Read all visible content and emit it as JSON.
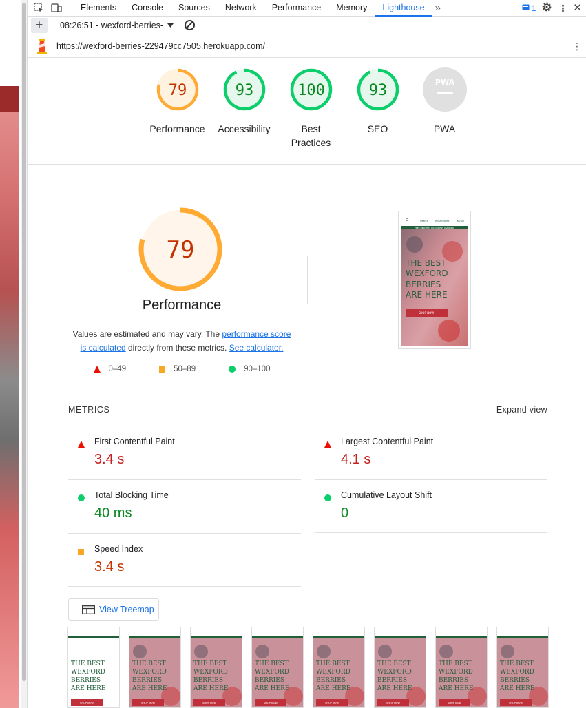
{
  "tabs": [
    "Elements",
    "Console",
    "Sources",
    "Network",
    "Performance",
    "Memory",
    "Lighthouse"
  ],
  "active_tab": "Lighthouse",
  "more_tabs_glyph": "»",
  "issues_count": "1",
  "toolbar": {
    "report_label": "08:26:51 - wexford-berries-",
    "add_glyph": "+"
  },
  "url": "https://wexford-berries-229479cc7505.herokuapp.com/",
  "gauges": [
    {
      "score": "79",
      "label": "Performance",
      "color": "#fa3",
      "text_color": "#c33300",
      "value": 79
    },
    {
      "score": "93",
      "label": "Accessibility",
      "color": "#0cce6b",
      "text_color": "#0a8a20",
      "value": 93
    },
    {
      "score": "100",
      "label": "Best Practices",
      "color": "#0cce6b",
      "text_color": "#0a8a20",
      "value": 100
    },
    {
      "score": "93",
      "label": "SEO",
      "color": "#0cce6b",
      "text_color": "#0a8a20",
      "value": 93
    },
    {
      "score": "PWA",
      "label": "PWA",
      "color": "#9e9e9e",
      "text_color": "#fff",
      "value": 0
    }
  ],
  "main": {
    "score": "79",
    "title": "Performance",
    "desc_1": "Values are estimated and may vary. The ",
    "link_1": "performance score",
    "link_1b": "is calculated",
    "desc_2": " directly from these metrics. ",
    "link_2": "See calculator.",
    "legend": [
      "0–49",
      "50–89",
      "90–100"
    ]
  },
  "preview": {
    "banner": "FREE DELIVERY ON ORDERS OVER €50",
    "headline": [
      "THE BEST",
      "WEXFORD",
      "BERRIES",
      "ARE HERE"
    ],
    "cta": "SHOP NOW",
    "nav": [
      "Search",
      "My Account",
      "€0.00"
    ]
  },
  "metrics": {
    "heading": "METRICS",
    "expand": "Expand view",
    "items": [
      {
        "name": "First Contentful Paint",
        "value": "3.4 s",
        "status": "fail"
      },
      {
        "name": "Largest Contentful Paint",
        "value": "4.1 s",
        "status": "fail"
      },
      {
        "name": "Total Blocking Time",
        "value": "40 ms",
        "status": "pass"
      },
      {
        "name": "Cumulative Layout Shift",
        "value": "0",
        "status": "pass"
      },
      {
        "name": "Speed Index",
        "value": "3.4 s",
        "status": "average"
      }
    ]
  },
  "treemap_label": "View Treemap",
  "colors": {
    "accent": "#1a73e8",
    "fail": "#eb0f00",
    "average": "#fa3",
    "pass": "#0cce6b"
  }
}
